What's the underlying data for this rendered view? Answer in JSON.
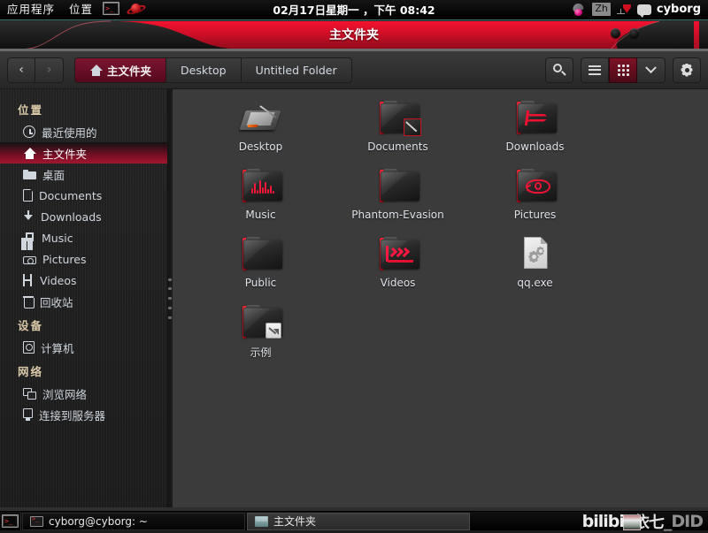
{
  "panel": {
    "menus": [
      "应用程序",
      "位置"
    ],
    "launchers": [
      {
        "name": "terminal-launcher"
      },
      {
        "name": "planet-launcher"
      }
    ],
    "clock": "02月17日星期一 ，下午 08:42",
    "tray": {
      "fedora_icon": "fedora-icon",
      "input_method": "Zh",
      "network_icon": "network-icon",
      "chat_icon": "chat-icon",
      "user": "cyborg"
    }
  },
  "window": {
    "title": "主文件夹",
    "buttons": [
      "minimize",
      "maximize"
    ]
  },
  "toolbar": {
    "back_label": "‹",
    "forward_label": "›",
    "crumbs": [
      {
        "label": "主文件夹",
        "icon": "home-icon",
        "selected": true
      },
      {
        "label": "Desktop",
        "icon": "",
        "selected": false
      },
      {
        "label": "Untitled Folder",
        "icon": "",
        "selected": false
      }
    ],
    "search_icon": "search-icon",
    "list_view_icon": "list-view-icon",
    "grid_view_icon": "grid-view-icon",
    "view_dropdown_icon": "chevron-down-icon",
    "settings_icon": "gear-icon"
  },
  "sidebar": {
    "sections": [
      {
        "header": "位置",
        "items": [
          {
            "label": "最近使用的",
            "icon": "clock-icon",
            "selected": false
          },
          {
            "label": "主文件夹",
            "icon": "home-icon",
            "selected": true
          },
          {
            "label": "桌面",
            "icon": "folder-icon",
            "selected": false
          },
          {
            "label": "Documents",
            "icon": "document-icon",
            "selected": false
          },
          {
            "label": "Downloads",
            "icon": "download-icon",
            "selected": false
          },
          {
            "label": "Music",
            "icon": "music-icon",
            "selected": false
          },
          {
            "label": "Pictures",
            "icon": "camera-icon",
            "selected": false
          },
          {
            "label": "Videos",
            "icon": "film-icon",
            "selected": false
          },
          {
            "label": "回收站",
            "icon": "trash-icon",
            "selected": false
          }
        ]
      },
      {
        "header": "设备",
        "items": [
          {
            "label": "计算机",
            "icon": "disk-icon",
            "selected": false
          }
        ]
      },
      {
        "header": "网络",
        "items": [
          {
            "label": "浏览网络",
            "icon": "network-browse-icon",
            "selected": false
          },
          {
            "label": "连接到服务器",
            "icon": "server-icon",
            "selected": false
          }
        ]
      }
    ]
  },
  "files": [
    {
      "label": "Desktop",
      "icon": "tablet-icon"
    },
    {
      "label": "Documents",
      "icon": "folder-documents-icon"
    },
    {
      "label": "Downloads",
      "icon": "folder-downloads-icon"
    },
    {
      "label": "Music",
      "icon": "folder-music-icon"
    },
    {
      "label": "Phantom-Evasion",
      "icon": "folder-icon"
    },
    {
      "label": "Pictures",
      "icon": "folder-pictures-icon"
    },
    {
      "label": "Public",
      "icon": "folder-icon"
    },
    {
      "label": "Videos",
      "icon": "folder-videos-icon"
    },
    {
      "label": "qq.exe",
      "icon": "executable-file-icon"
    },
    {
      "label": "示例",
      "icon": "folder-symlink-icon"
    }
  ],
  "taskbar": {
    "launcher_icon": "terminal-icon",
    "tasks": [
      {
        "label": "cyborg@cyborg: ~",
        "icon": "terminal-icon",
        "active": false
      },
      {
        "label": "主文件夹",
        "icon": "file-manager-icon",
        "active": true
      }
    ],
    "watermark": {
      "brand": "bilibili",
      "user_cn": "依七",
      "user_tail": "_DID"
    }
  },
  "colors": {
    "accent_red": "#d2102a",
    "selected_maroon": "#7d1530",
    "panel_black": "#0a0a0a",
    "content_gray": "#3b3b3b",
    "sidebar_gray": "#232323"
  }
}
